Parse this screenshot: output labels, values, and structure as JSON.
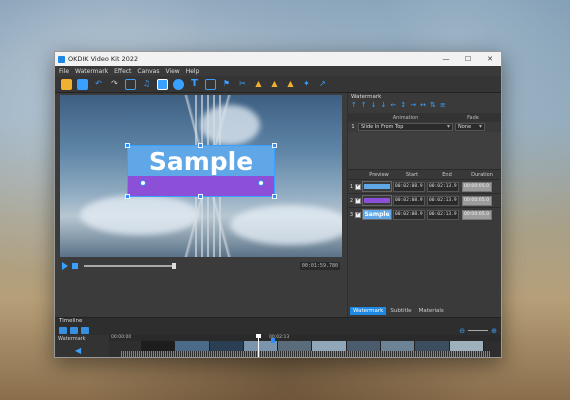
{
  "window": {
    "title": "OKDIK Video Kit 2022",
    "controls": [
      "—",
      "☐",
      "✕"
    ]
  },
  "menu": [
    "File",
    "Watermark",
    "Effect",
    "Canvas",
    "View",
    "Help"
  ],
  "toolbar": {
    "icons": [
      "open-icon",
      "save-icon",
      "undo-icon",
      "redo-icon",
      "video-icon",
      "audio-icon",
      "image-icon",
      "shape-icon",
      "text-icon",
      "subtitle-icon",
      "filter-icon",
      "crop-icon",
      "sticker-icon",
      "mosaic-icon",
      "transition-icon",
      "effect-icon",
      "export-icon"
    ],
    "colors": {
      "open": "#f0b030",
      "save": "#3aa0ff",
      "accent": "#3aa0ff"
    }
  },
  "preview": {
    "watermark_text": "Sample",
    "time_readout": "00:01:59.780"
  },
  "watermark_panel": {
    "title": "Watermark",
    "animation_header": "Animation",
    "fade_header": "Fade",
    "row_index": "1",
    "animation_value": "Slide In From Top",
    "fade_value": "None",
    "table_headers": {
      "preview": "Preview",
      "start": "Start",
      "end": "End",
      "duration": "Duration"
    },
    "rows": [
      {
        "index": "1",
        "start": "00:02:08.9",
        "end": "00:02:13.9",
        "preview_color": "#5fa7e6",
        "duration": "00:00:05.0"
      },
      {
        "index": "2",
        "start": "00:02:08.9",
        "end": "00:02:13.9",
        "preview_color": "#8b4fd8",
        "duration": "00:00:05.0"
      },
      {
        "index": "3",
        "start": "00:02:08.9",
        "end": "00:02:13.9",
        "preview_text": "Sample",
        "duration": "00:00:05.0"
      }
    ],
    "tabs": [
      "Watermark",
      "Subtitle",
      "Materials"
    ],
    "active_tab": "Watermark"
  },
  "timeline": {
    "label": "Timeline",
    "track_name": "Watermark",
    "ruler_start": "00:00:00",
    "ruler_mark": "00:02:13",
    "accent": "#3aa0ff"
  }
}
